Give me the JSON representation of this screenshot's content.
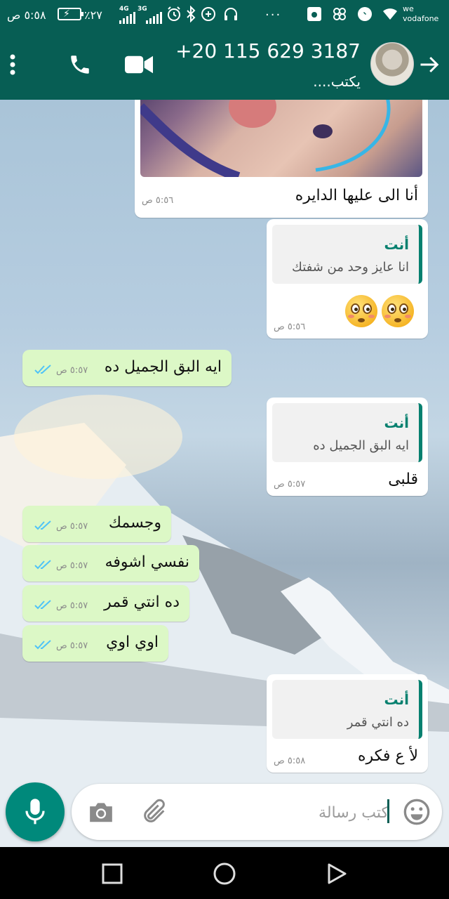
{
  "status_bar": {
    "time": "٥:٥٨ ص",
    "battery_percent": "٪٢٧",
    "network_1": "4G",
    "network_2": "3G",
    "carrier": "we vodafone",
    "carrier_line1": "we",
    "carrier_line2": "vodafone",
    "more": "···",
    "icons": [
      "battery-icon",
      "signal-icon",
      "signal-icon",
      "alarm-icon",
      "bluetooth-icon",
      "data-saver-icon",
      "headphones-icon",
      "more-dots",
      "gallery-icon",
      "app-icon",
      "messenger-icon",
      "wifi-icon"
    ]
  },
  "header": {
    "contact_name": "+20 115 629 3187",
    "status": "يكتب....",
    "icons": [
      "back-arrow-icon",
      "avatar",
      "video-call-icon",
      "voice-call-icon",
      "menu-icon"
    ]
  },
  "messages": [
    {
      "dir": "in",
      "type": "image",
      "caption": "أنا الى عليها الدايره",
      "time": "٥:٥٦ ص"
    },
    {
      "dir": "in",
      "type": "reply",
      "quote_author": "أنت",
      "quote_text": "انا عايز وحد من شفتك",
      "text": "😳😳",
      "time": "٥:٥٦ ص"
    },
    {
      "dir": "out",
      "type": "text",
      "text": "ايه البق الجميل ده",
      "time": "٥:٥٧ ص",
      "read": true
    },
    {
      "dir": "in",
      "type": "reply",
      "quote_author": "أنت",
      "quote_text": "ايه البق الجميل ده",
      "text": "قلبى",
      "time": "٥:٥٧ ص"
    },
    {
      "dir": "out",
      "type": "text",
      "text": "وجسمك",
      "time": "٥:٥٧ ص",
      "read": true
    },
    {
      "dir": "out",
      "type": "text",
      "text": "نفسي اشوفه",
      "time": "٥:٥٧ ص",
      "read": true
    },
    {
      "dir": "out",
      "type": "text",
      "text": "ده انتي قمر",
      "time": "٥:٥٧ ص",
      "read": true
    },
    {
      "dir": "out",
      "type": "text",
      "text": "اوي اوي",
      "time": "٥:٥٧ ص",
      "read": true
    },
    {
      "dir": "in",
      "type": "reply",
      "quote_author": "أنت",
      "quote_text": "ده انتي قمر",
      "text": "لأ ع فكره",
      "time": "٥:٥٨ ص"
    }
  ],
  "input": {
    "placeholder": "كتب رسالة",
    "icons": [
      "emoji-icon",
      "attach-icon",
      "camera-icon",
      "mic-icon"
    ]
  },
  "colors": {
    "header": "#075e54",
    "accent": "#00897b",
    "outgoing_bubble": "#dcf8c6",
    "incoming_bubble": "#ffffff",
    "read_ticks": "#4fc3f7",
    "quote_bar": "#06806f"
  },
  "nav": {
    "icons": [
      "recents-icon",
      "home-icon",
      "back-icon"
    ]
  }
}
